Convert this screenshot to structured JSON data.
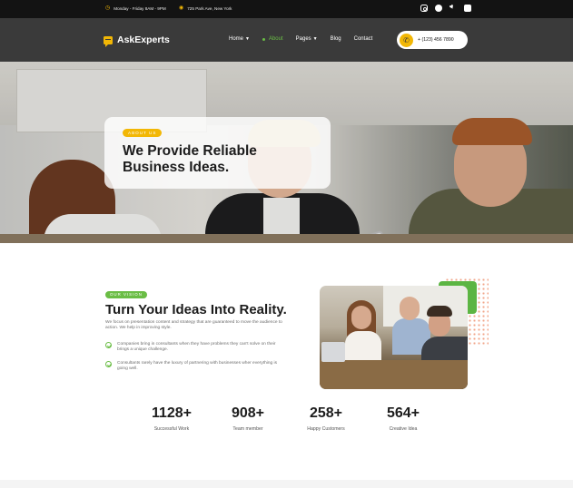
{
  "topbar": {
    "hours": "Monday - Friday 8AM - 9PM",
    "address": "725 Park Ave, New York",
    "hours_icon": "clock-icon",
    "address_icon": "location-pin-icon",
    "socials": [
      "instagram-icon",
      "facebook-icon",
      "twitter-icon",
      "linkedin-icon"
    ]
  },
  "header": {
    "brand": "AskExperts",
    "nav": [
      {
        "label": "Home",
        "dropdown": true
      },
      {
        "label": "About",
        "active": true
      },
      {
        "label": "Pages",
        "dropdown": true
      },
      {
        "label": "Blog"
      },
      {
        "label": "Contact"
      }
    ],
    "phone": "+ (123) 456 7890"
  },
  "hero": {
    "tag": "ABOUT US",
    "title": "We Provide Reliable Business Ideas."
  },
  "vision": {
    "tag": "OUR VISION",
    "title": "Turn Your Ideas Into Reality.",
    "description": "We focus on presentation content and strategy that are guaranteed to move the audience to action. We help in improving style.",
    "points": [
      "Companies bring in consultants when they have problems they can't solve on their brings a unique challenge.",
      "Consultants rarely have the luxury of partnering with businesses wher everything is going well."
    ]
  },
  "stats": [
    {
      "value": "1128+",
      "label": "Successful Work"
    },
    {
      "value": "908+",
      "label": "Team member"
    },
    {
      "value": "258+",
      "label": "Happy Customers"
    },
    {
      "value": "564+",
      "label": "Creative Idea"
    }
  ],
  "colors": {
    "accent_yellow": "#f2b705",
    "accent_green": "#6abd45",
    "header_bg": "#3a3a3a",
    "topbar_bg": "#131313"
  }
}
